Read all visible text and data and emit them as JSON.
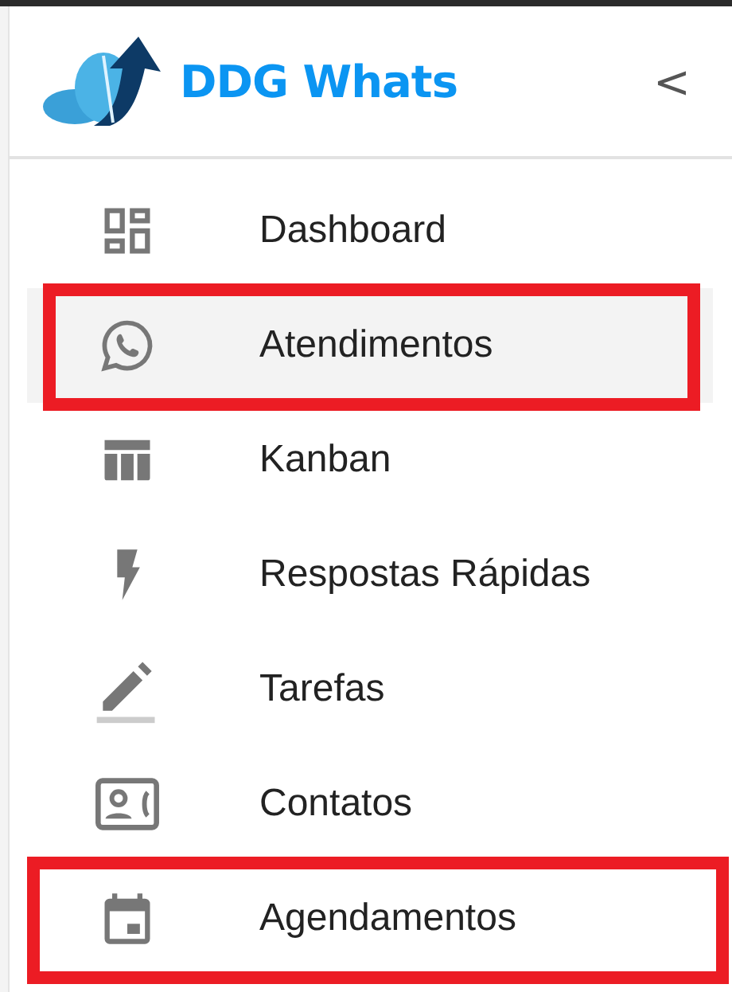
{
  "header": {
    "brand": "DDG Whats",
    "collapse_glyph": "<"
  },
  "menu": [
    {
      "label": "Dashboard",
      "selected": false,
      "highlighted": false
    },
    {
      "label": "Atendimentos",
      "selected": true,
      "highlighted": true
    },
    {
      "label": "Kanban",
      "selected": false,
      "highlighted": false
    },
    {
      "label": "Respostas Rápidas",
      "selected": false,
      "highlighted": false
    },
    {
      "label": "Tarefas",
      "selected": false,
      "highlighted": false
    },
    {
      "label": "Contatos",
      "selected": false,
      "highlighted": false
    },
    {
      "label": "Agendamentos",
      "selected": false,
      "highlighted": true
    }
  ]
}
